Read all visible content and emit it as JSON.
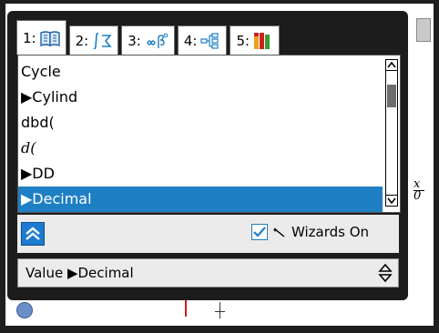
{
  "tabs": [
    {
      "number": "1:",
      "icon": "catalog-book-icon",
      "active": true
    },
    {
      "number": "2:",
      "icon": "integral-sigma-icon",
      "active": false
    },
    {
      "number": "3:",
      "icon": "infinity-beta-icon",
      "active": false
    },
    {
      "number": "4:",
      "icon": "library-objects-icon",
      "active": false
    },
    {
      "number": "5:",
      "icon": "templates-palette-icon",
      "active": false
    }
  ],
  "list": {
    "items": [
      {
        "label": "Cycle"
      },
      {
        "label": "▶Cylind"
      },
      {
        "label": "dbd("
      },
      {
        "label": "d("
      },
      {
        "label": "▶DD"
      },
      {
        "label": "▶Decimal"
      }
    ],
    "selected_index": 5,
    "scroll_position": 0.14
  },
  "options": {
    "expand_icon": "double-chevron-up-icon",
    "wizards_checked": true,
    "wizards_icon": "magic-wand-icon",
    "wizards_label": "Wizards On"
  },
  "syntax": {
    "value": "Value ▶Decimal",
    "spinner_icon": "up-down-spinner-icon"
  },
  "colors": {
    "selection": "#1f7fc5",
    "dialog_background": "#1c1c1c",
    "panel_background": "#ebebeb"
  }
}
